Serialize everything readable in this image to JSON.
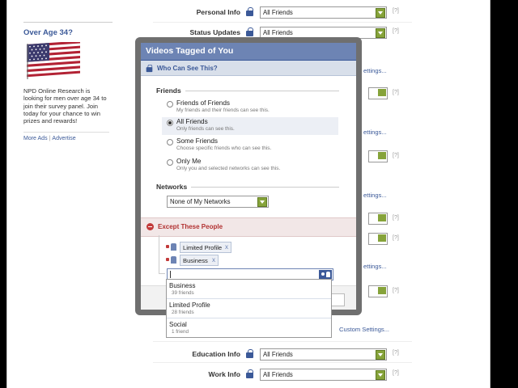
{
  "ad": {
    "title": "Over Age 34?",
    "body": "NPD Online Research is looking for men over age 34 to join their survey panel. Join today for your chance to win prizes and rewards!",
    "more_ads": "More Ads",
    "separator": "|",
    "advertise": "Advertise"
  },
  "settings": {
    "rows": [
      {
        "label": "Personal Info",
        "value": "All Friends",
        "help": "[?]"
      },
      {
        "label": "Status Updates",
        "value": "All Friends",
        "help": "[?]"
      },
      {
        "label": "Education Info",
        "value": "All Friends",
        "help": "[?]"
      },
      {
        "label": "Work Info",
        "value": "All Friends",
        "help": "[?]"
      }
    ],
    "partial_link": "ettings...",
    "custom_settings_link": "Custom Settings...",
    "help": "[?]"
  },
  "modal": {
    "title": "Videos Tagged of You",
    "subtitle": "Who Can See This?",
    "friends_heading": "Friends",
    "options": [
      {
        "label": "Friends of Friends",
        "desc": "My friends and their friends can see this.",
        "selected": false
      },
      {
        "label": "All Friends",
        "desc": "Only friends can see this.",
        "selected": true
      },
      {
        "label": "Some Friends",
        "desc": "Choose specific friends who can see this.",
        "selected": false
      },
      {
        "label": "Only Me",
        "desc": "Only you and selected networks can see this.",
        "selected": false
      }
    ],
    "networks_heading": "Networks",
    "networks_value": "None of My Networks",
    "except_heading": "Except These People",
    "excluded": [
      {
        "label": "Limited Profile",
        "remove": "x"
      },
      {
        "label": "Business",
        "remove": "x"
      }
    ],
    "typeahead_value": ""
  },
  "dropdown": {
    "items": [
      {
        "name": "Business",
        "count": "39 friends"
      },
      {
        "name": "Limited Profile",
        "count": "28 friends"
      },
      {
        "name": "Social",
        "count": "1 friend"
      }
    ]
  },
  "colors": {
    "header_blue": "#6d84b4",
    "brand_blue": "#3b5998",
    "except_red": "#b23232",
    "select_green": "#86a33a"
  }
}
